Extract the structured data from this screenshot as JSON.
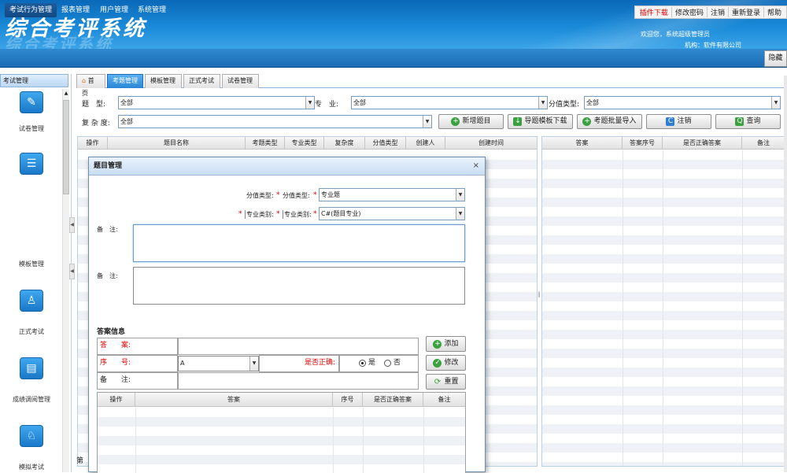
{
  "header": {
    "title": "综合考评系统",
    "top_links": [
      "插件下载",
      "修改密码",
      "注销",
      "重新登录",
      "帮助"
    ],
    "welcome": "欢迎您，系统超级管理员",
    "org": "机构：软件有限公司"
  },
  "menu": {
    "items": [
      "考试行为管理",
      "报表管理",
      "用户管理",
      "系统管理"
    ],
    "hide_label": "隐藏"
  },
  "sidebar": {
    "title": "考试管理",
    "items": [
      {
        "label": "试卷管理",
        "icon": "book-icon"
      },
      {
        "label": "",
        "icon": "list-icon"
      },
      {
        "label": "模板管理",
        "icon": "template-icon"
      },
      {
        "label": "正式考试",
        "icon": "exam-icon"
      },
      {
        "label": "成绩调阅管理",
        "icon": "score-icon"
      },
      {
        "label": "模拟考试",
        "icon": "mock-exam-icon"
      }
    ]
  },
  "tabs": [
    "首页",
    "考题管理",
    "模板管理",
    "正式考试",
    "试卷管理"
  ],
  "filters": {
    "type_label": "题　型:",
    "type_value": "全部",
    "major_label": "专　业:",
    "major_value": "全部",
    "score_type_label": "分值类型:",
    "score_type_value": "全部",
    "complexity_label": "复 杂 度:",
    "complexity_value": "全部"
  },
  "actions": [
    "新增题目",
    "导题模板下载",
    "考题批量导入",
    "注销",
    "查询"
  ],
  "grid_left": {
    "columns": [
      "操作",
      "题目名称",
      "考题类型",
      "专业类型",
      "复杂度",
      "分值类型",
      "创建人",
      "创建时间"
    ]
  },
  "grid_right": {
    "columns": [
      "答案",
      "答案序号",
      "是否正确答案",
      "备注"
    ]
  },
  "pager_text": "第",
  "modal": {
    "title": "题目管理",
    "close": "×",
    "score_type_label": "分值类型:",
    "score_type_label2": "分值类型:",
    "score_type_value": "专业题",
    "major_type_label": "专业类别:",
    "major_type_label2": "专业类别:",
    "major_type_value": "C#(题目专业)",
    "note_label": "备　注:",
    "note2_label": "备　注:",
    "answer_section": "答案信息",
    "answer_label": "答　　案:",
    "seq_label": "序　　号:",
    "seq_value": "A",
    "correct_label": "是否正确:",
    "yes": "是",
    "no": "否",
    "remark_label": "备　　注:",
    "add_btn": "添加",
    "edit_btn": "修改",
    "reset_btn": "重置",
    "required_mark": "*",
    "answer_grid_columns": [
      "操作",
      "答案",
      "序号",
      "是否正确答案",
      "备注"
    ]
  }
}
